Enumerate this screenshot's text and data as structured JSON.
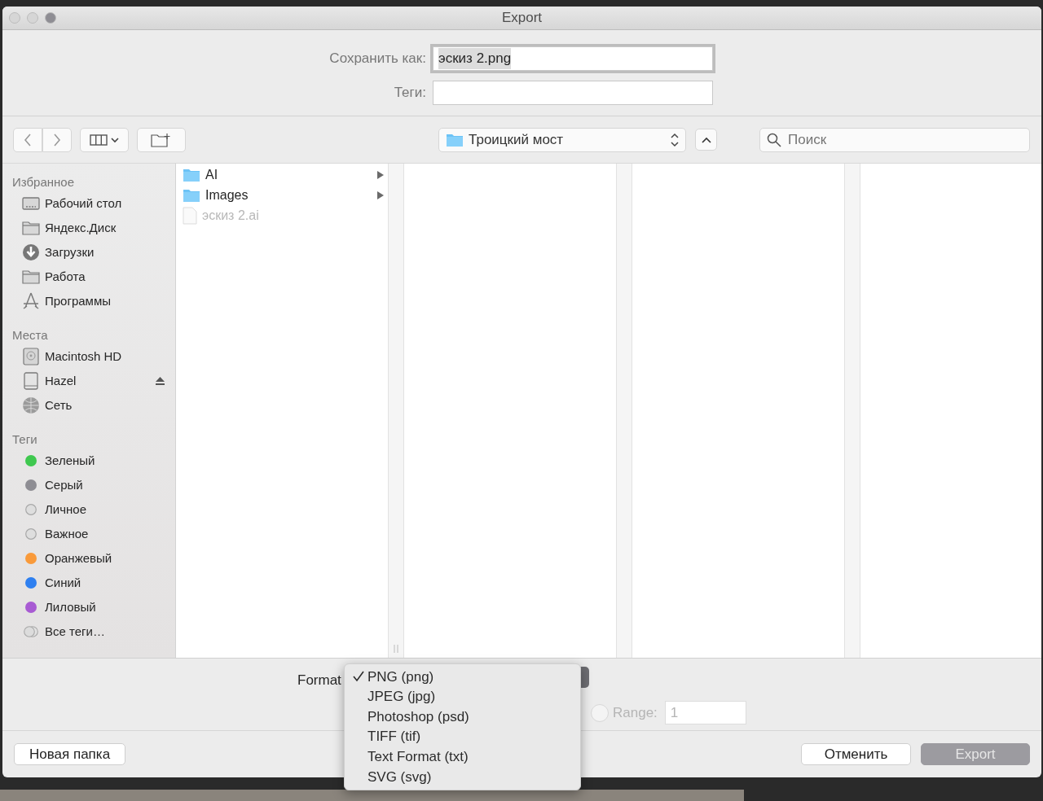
{
  "window": {
    "title": "Export"
  },
  "save_as": {
    "label": "Сохранить как:",
    "value": "эскиз 2.png"
  },
  "tags_field": {
    "label": "Теги:"
  },
  "toolbar": {
    "location": "Троицкий мост",
    "search": {
      "placeholder": "Поиск"
    }
  },
  "sidebar": {
    "sections": [
      {
        "title": "Избранное",
        "items": [
          {
            "label": "Рабочий стол",
            "kind": "desktop"
          },
          {
            "label": "Яндекс.Диск",
            "kind": "folder"
          },
          {
            "label": "Загрузки",
            "kind": "downloads"
          },
          {
            "label": "Работа",
            "kind": "folder"
          },
          {
            "label": "Программы",
            "kind": "apps"
          }
        ]
      },
      {
        "title": "Места",
        "items": [
          {
            "label": "Macintosh HD",
            "kind": "disk"
          },
          {
            "label": "Hazel",
            "kind": "ejectable"
          },
          {
            "label": "Сеть",
            "kind": "network"
          }
        ]
      },
      {
        "title": "Теги",
        "items": [
          {
            "label": "Зеленый",
            "kind": "tag",
            "color": "#3fc84f"
          },
          {
            "label": "Серый",
            "kind": "tag",
            "color": "#8e8d93"
          },
          {
            "label": "Личное",
            "kind": "tag_blank"
          },
          {
            "label": "Важное",
            "kind": "tag_blank"
          },
          {
            "label": "Оранжевый",
            "kind": "tag",
            "color": "#f99a3a"
          },
          {
            "label": "Синий",
            "kind": "tag",
            "color": "#2f80f0"
          },
          {
            "label": "Лиловый",
            "kind": "tag",
            "color": "#a85bd3"
          },
          {
            "label": "Все теги…",
            "kind": "all_tags"
          }
        ]
      }
    ]
  },
  "browser_column": {
    "items": [
      {
        "label": "AI",
        "kind": "folder",
        "disabled": false
      },
      {
        "label": "Images",
        "kind": "folder",
        "disabled": false
      },
      {
        "label": "эскиз 2.ai",
        "kind": "file",
        "disabled": true
      }
    ]
  },
  "options": {
    "format_label": "Format",
    "range": {
      "label": "Range:",
      "value": "1",
      "selected": false,
      "disabled": true
    }
  },
  "format_menu": {
    "items": [
      {
        "label": "PNG (png)",
        "selected": true
      },
      {
        "label": "JPEG (jpg)",
        "selected": false
      },
      {
        "label": "Photoshop (psd)",
        "selected": false
      },
      {
        "label": "TIFF (tif)",
        "selected": false
      },
      {
        "label": "Text Format (txt)",
        "selected": false
      },
      {
        "label": "SVG (svg)",
        "selected": false
      }
    ]
  },
  "buttons": {
    "new_folder": "Новая папка",
    "cancel": "Отменить",
    "export": {
      "label": "Export",
      "disabled": true
    }
  }
}
